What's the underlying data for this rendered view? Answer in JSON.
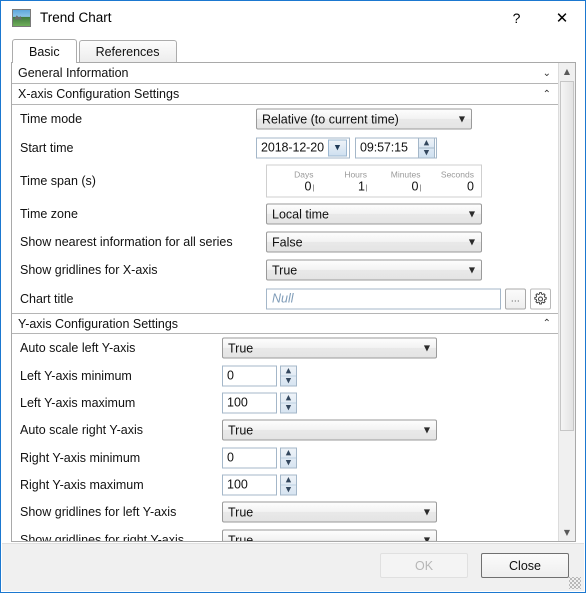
{
  "window": {
    "title": "Trend Chart",
    "icon": "image-thumbnail-icon",
    "help_label": "?",
    "close_label": "✕",
    "accent_color": "#1b78d0"
  },
  "tabs": [
    {
      "label": "Basic",
      "active": true
    },
    {
      "label": "References",
      "active": false
    }
  ],
  "sections": {
    "general": {
      "title": "General Information",
      "state": "collapsed",
      "chevron": "⌄"
    },
    "xaxis": {
      "title": "X-axis Configuration Settings",
      "state": "expanded",
      "chevron": "⌃"
    },
    "yaxis": {
      "title": "Y-axis Configuration Settings",
      "state": "expanded",
      "chevron": "⌃"
    }
  },
  "xaxis_rows": {
    "time_mode": {
      "label": "Time mode",
      "value": "Relative (to current time)"
    },
    "start_time": {
      "label": "Start time",
      "date": "2018-12-20",
      "time": "09:57:15"
    },
    "time_span": {
      "label": "Time span (s)",
      "fields": [
        {
          "caption": "Days",
          "value": "0"
        },
        {
          "caption": "Hours",
          "value": "1"
        },
        {
          "caption": "Minutes",
          "value": "0"
        },
        {
          "caption": "Seconds",
          "value": "0"
        }
      ]
    },
    "time_zone": {
      "label": "Time zone",
      "value": "Local time"
    },
    "show_nearest": {
      "label": "Show nearest information for all series",
      "value": "False"
    },
    "gridlines_x": {
      "label": "Show gridlines for X-axis",
      "value": "True"
    },
    "chart_title": {
      "label": "Chart title",
      "value": "",
      "placeholder": "Null",
      "browse_label": "...",
      "settings_icon": "gear-icon"
    }
  },
  "yaxis_rows": {
    "auto_scale_left": {
      "label": "Auto scale left Y-axis",
      "value": "True"
    },
    "left_min": {
      "label": "Left Y-axis minimum",
      "value": "0"
    },
    "left_max": {
      "label": "Left Y-axis maximum",
      "value": "100"
    },
    "auto_scale_right": {
      "label": "Auto scale right Y-axis",
      "value": "True"
    },
    "right_min": {
      "label": "Right Y-axis minimum",
      "value": "0"
    },
    "right_max": {
      "label": "Right Y-axis maximum",
      "value": "100"
    },
    "gridlines_left": {
      "label": "Show gridlines for left Y-axis",
      "value": "True"
    },
    "gridlines_right": {
      "label": "Show gridlines for right Y-axis",
      "value": "True"
    }
  },
  "scrollbar": {
    "up_arrow": "▲",
    "down_arrow": "▼"
  },
  "footer": {
    "ok_label": "OK",
    "ok_enabled": false,
    "close_label": "Close",
    "close_enabled": true
  },
  "glyphs": {
    "combo_arrow": "▼",
    "spin_up": "▲",
    "spin_down": "▼",
    "date_arrow": "▼"
  }
}
